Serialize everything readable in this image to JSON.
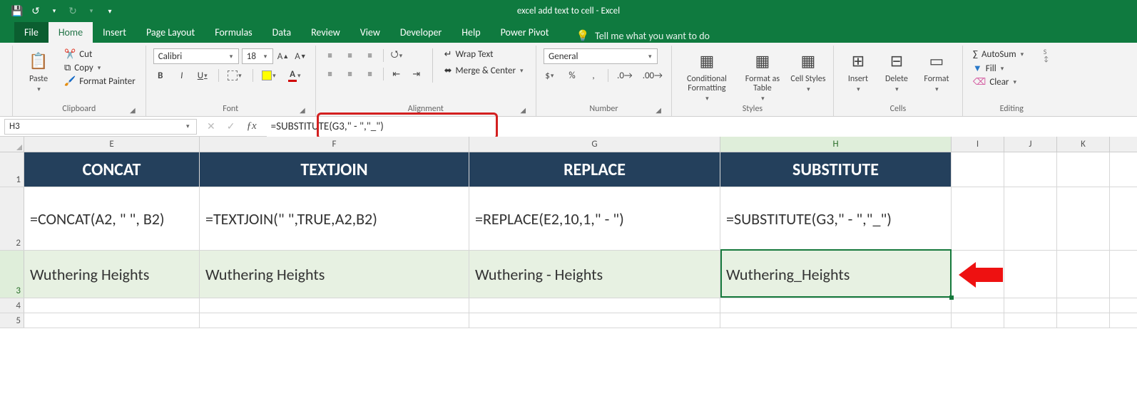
{
  "window": {
    "title": "excel add text to cell  -  Excel"
  },
  "qat": {
    "save": "",
    "undo": "",
    "redo": "",
    "more": ""
  },
  "tabs": {
    "file": "File",
    "home": "Home",
    "insert": "Insert",
    "pagelayout": "Page Layout",
    "formulas": "Formulas",
    "data": "Data",
    "review": "Review",
    "view": "View",
    "developer": "Developer",
    "help": "Help",
    "powerpivot": "Power Pivot",
    "tellme": "Tell me what you want to do"
  },
  "ribbon": {
    "clipboard": {
      "label": "Clipboard",
      "paste": "Paste",
      "cut": "Cut",
      "copy": "Copy",
      "formatpainter": "Format Painter"
    },
    "font": {
      "label": "Font",
      "name": "Calibri",
      "size": "18",
      "bold": "B",
      "italic": "I",
      "underline": "U"
    },
    "alignment": {
      "label": "Alignment",
      "wrap": "Wrap Text",
      "merge": "Merge & Center"
    },
    "number": {
      "label": "Number",
      "format": "General",
      "currency": "$",
      "percent": "%",
      "comma": ",",
      "incdec": ".0",
      "decinc": ".00"
    },
    "styles": {
      "label": "Styles",
      "cond": "Conditional Formatting",
      "table": "Format as Table",
      "cell": "Cell Styles"
    },
    "cells": {
      "label": "Cells",
      "insert": "Insert",
      "delete": "Delete",
      "format": "Format"
    },
    "editing": {
      "label": "Editing",
      "autosum": "AutoSum",
      "fill": "Fill",
      "clear": "Clear"
    }
  },
  "formulaBar": {
    "nameBox": "H3",
    "formula": "=SUBSTITUTE(G3,\" - \",\"_\")"
  },
  "columns": {
    "E": "E",
    "F": "F",
    "G": "G",
    "H": "H",
    "I": "I",
    "J": "J",
    "K": "K"
  },
  "rows": {
    "r1": "1",
    "r2": "2",
    "r3": "3",
    "r4": "4",
    "r5": "5"
  },
  "grid": {
    "header": {
      "E": "CONCAT",
      "F": "TEXTJOIN",
      "G": "REPLACE",
      "H": "SUBSTITUTE"
    },
    "row2": {
      "E": "=CONCAT(A2, \" \", B2)",
      "F": "=TEXTJOIN(\" \",TRUE,A2,B2)",
      "G": "=REPLACE(E2,10,1,\" - \")",
      "H": "=SUBSTITUTE(G3,\" - \",\"_\")"
    },
    "row3": {
      "E": "Wuthering Heights",
      "F": "Wuthering Heights",
      "G": "Wuthering - Heights",
      "H": "Wuthering_Heights"
    }
  }
}
